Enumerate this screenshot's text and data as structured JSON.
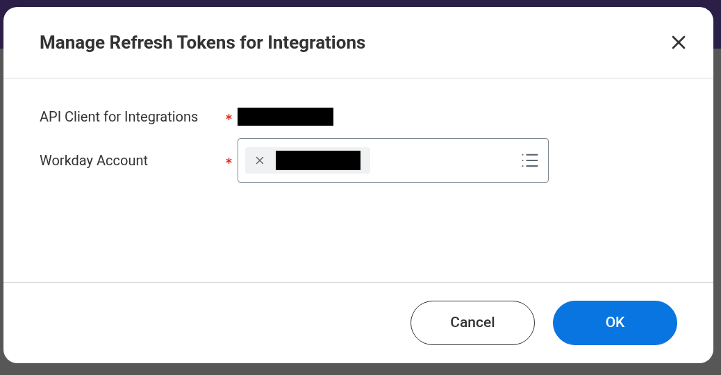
{
  "dialog": {
    "title": "Manage Refresh Tokens for Integrations",
    "fields": [
      {
        "kind": "readonly",
        "label": "API Client for Integrations",
        "required": true,
        "redacted": true
      },
      {
        "kind": "multiselect",
        "label": "Workday Account",
        "required": true,
        "chips": [
          {
            "redacted": true
          }
        ]
      }
    ],
    "buttons": [
      {
        "label": "Cancel",
        "kind": "secondary"
      },
      {
        "label": "OK",
        "kind": "primary"
      }
    ]
  }
}
